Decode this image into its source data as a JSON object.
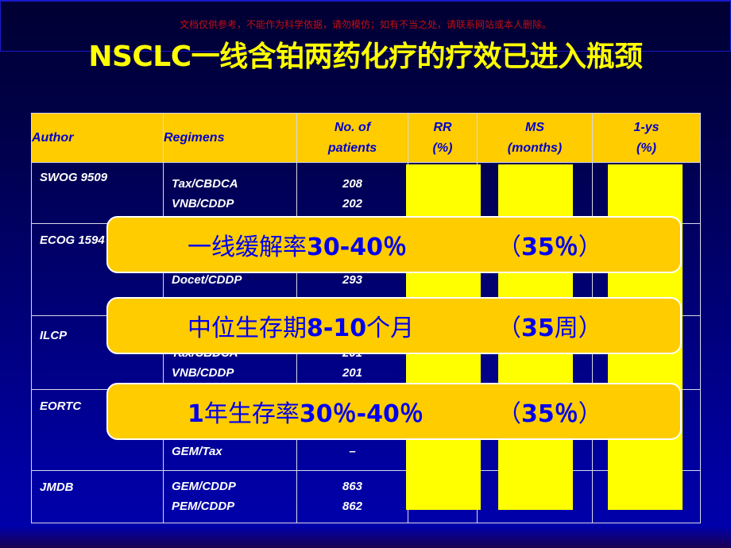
{
  "watermark": "文档仅供参考，不能作为科学依据，请勿模仿；如有不当之处，请联系网站或本人删除。",
  "title": "NSCLC一线含铂两药化疗的疗效已进入瓶颈",
  "table": {
    "headers": {
      "author": "Author",
      "regimens": "Regimens",
      "patients_line1": "No. of",
      "patients_line2": "patients",
      "rr_line1": "RR",
      "rr_line2": "(%)",
      "ms_line1": "MS",
      "ms_line2": "(months)",
      "ys_line1": "1-ys",
      "ys_line2": "(%)"
    },
    "rows": [
      {
        "author": "SWOG 9509",
        "regimens": [
          "Tax/CBDCA",
          "VNB/CDDP"
        ],
        "patients": [
          "208",
          "202"
        ]
      },
      {
        "author": "ECOG 1594",
        "regimens": [
          "Docet/CDDP"
        ],
        "patients": [
          "293"
        ]
      },
      {
        "author": "ILCP",
        "regimens": [
          "Tax/CBDCA",
          "VNB/CDDP"
        ],
        "patients": [
          "201",
          "201"
        ]
      },
      {
        "author": "EORTC",
        "regimens": [
          "GEM/Tax"
        ],
        "patients": [
          "–"
        ]
      },
      {
        "author": "JMDB",
        "regimens": [
          "GEM/CDDP",
          "PEM/CDDP"
        ],
        "patients": [
          "863",
          "862"
        ]
      }
    ]
  },
  "callouts": [
    {
      "main": "一线缓解率",
      "value": "30-40％",
      "paren_open": "（",
      "paren_value": "35％",
      "paren_close": "）"
    },
    {
      "main": "中位生存期",
      "value": "8-10",
      "unit": "个月",
      "paren_open": "（",
      "paren_value": "35",
      "paren_unit": "周",
      "paren_close": "）"
    },
    {
      "main_prefix": "1",
      "main": "年生存率",
      "value": "30％-40％",
      "paren_open": "（",
      "paren_value": "35％",
      "paren_close": "）"
    }
  ],
  "colors": {
    "title": "#ffff00",
    "header_bg": "#ffcc00",
    "header_text": "#0000cc",
    "mask": "#ffff00",
    "callout_bg": "#ffcc00",
    "callout_text": "#0000ee",
    "watermark": "#c01010"
  }
}
